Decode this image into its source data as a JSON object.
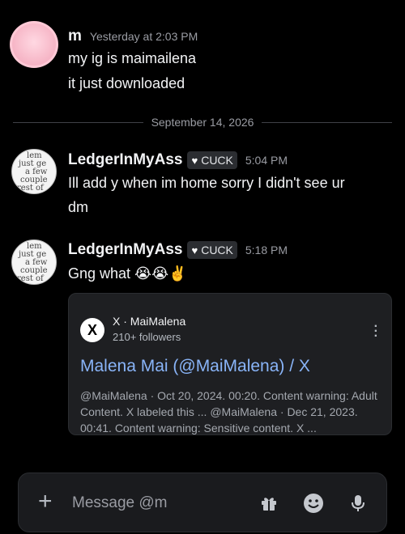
{
  "messages": [
    {
      "author": "m",
      "timestamp": "Yesterday at 2:03 PM",
      "lines": [
        "my ig is maimailena",
        "it just downloaded"
      ]
    }
  ],
  "date_divider": "September 14, 2026",
  "messages2": [
    {
      "author": "LedgerInMyAss",
      "tag": "CUCK",
      "timestamp": "5:04 PM",
      "line1": "Ill add y when im home sorry I didn't see ur",
      "line2": "dm"
    },
    {
      "author": "LedgerInMyAss",
      "tag": "CUCK",
      "timestamp": "5:18 PM",
      "text": "Gng what 😭😭✌️"
    }
  ],
  "embed": {
    "provider": "X · MaiMalena",
    "followers": "210+ followers",
    "title": "Malena Mai (@MaiMalena) / X",
    "description": "@MaiMalena · Oct 20, 2024. 00:20. Content warning: Adult Content. X labeled this ... @MaiMalena · Dec 21, 2023. 00:41. Content warning: Sensitive content. X ..."
  },
  "composer": {
    "placeholder": "Message @m"
  },
  "icons": [
    "plus-icon",
    "gift-icon",
    "emoji-icon",
    "mic-icon",
    "x-logo-icon",
    "kebab-icon"
  ]
}
